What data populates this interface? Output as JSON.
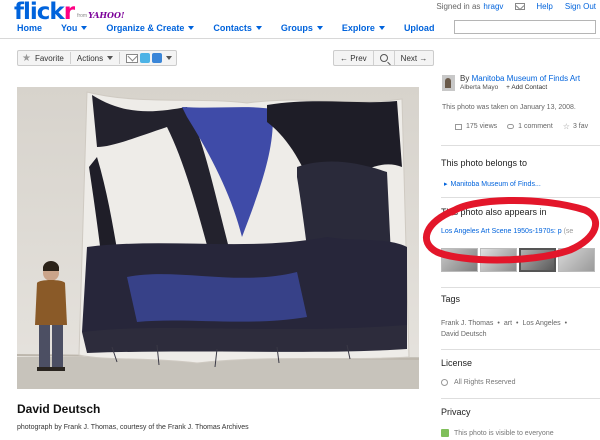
{
  "header": {
    "logo_main": "flick",
    "logo_accent": "r",
    "logo_from": "from",
    "logo_partner": "YAHOO!",
    "signed_in_as": "Signed in as",
    "username": "hragv",
    "help": "Help",
    "sign_out": "Sign Out",
    "nav": [
      {
        "label": "Home",
        "has_menu": false
      },
      {
        "label": "You",
        "has_menu": true
      },
      {
        "label": "Organize & Create",
        "has_menu": true
      },
      {
        "label": "Contacts",
        "has_menu": true
      },
      {
        "label": "Groups",
        "has_menu": true
      },
      {
        "label": "Explore",
        "has_menu": true
      },
      {
        "label": "Upload",
        "has_menu": false
      }
    ],
    "search": {
      "value": "",
      "placeholder": ""
    }
  },
  "toolbar": {
    "favorite": "Favorite",
    "actions": "Actions",
    "prev": "← Prev",
    "next": "Next →"
  },
  "photo": {
    "title": "David Deutsch",
    "description": "photograph by Frank J. Thomas, courtesy of the Frank J. Thomas Archives"
  },
  "sidebar": {
    "owner": {
      "by": "By",
      "name": "Manitoba Museum of Finds Art",
      "person": "Alberta Mayo",
      "add_contact": "+ Add Contact"
    },
    "taken": "This photo was taken on January 13, 2008.",
    "stats": {
      "views": "175 views",
      "comments": "1 comment",
      "favorites": "3 fav"
    },
    "belongs_heading": "This photo belongs to",
    "belongs_item": "Manitoba Museum of Finds...",
    "appears_heading": "This photo also appears in",
    "appears_item": "Los Angeles Art Scene 1950s-1970s: p",
    "appears_tail": "(se",
    "tags_heading": "Tags",
    "tags": [
      "Frank J. Thomas",
      "art",
      "Los Angeles",
      "David Deutsch"
    ],
    "license_heading": "License",
    "license": "All Rights Reserved",
    "privacy_heading": "Privacy",
    "privacy": "This photo is visible to everyone"
  },
  "colors": {
    "flickr_blue": "#0063dc",
    "flickr_pink": "#ff0084",
    "annotation_red": "#e3162a"
  }
}
